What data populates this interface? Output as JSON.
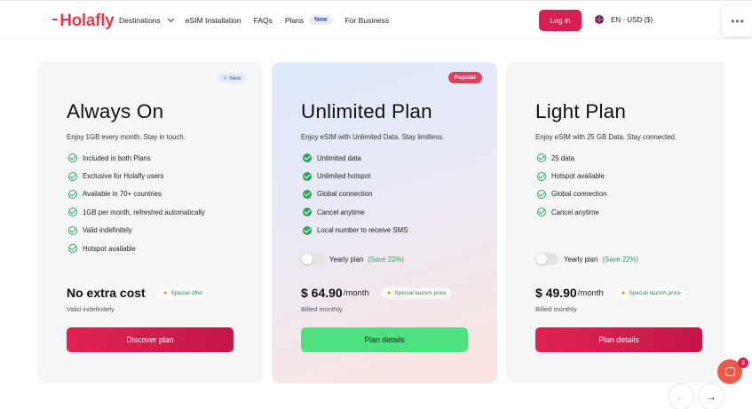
{
  "header": {
    "logo": "Holafly",
    "nav": [
      {
        "label": "Destinations"
      },
      {
        "label": "eSIM Installation"
      },
      {
        "label": "FAQs"
      },
      {
        "label": "Plans",
        "badge": "New"
      },
      {
        "label": "For Business"
      }
    ],
    "login_label": "Log in",
    "language": "EN - USD ($)",
    "more_icon": "ellipsis-icon"
  },
  "cards": [
    {
      "tag": "New",
      "title": "Always On",
      "description": "Enjoy 1GB every month. Stay in touch.",
      "features": [
        "Included in both Plans",
        "Exclusive for Holafly users",
        "Available in 70+ countries",
        "1GB per month, refreshed automatically",
        "Valid indefinitely",
        "Hotspot available"
      ],
      "price": "No extra cost",
      "offer": "Special offer",
      "billing": "Valid indefinitely",
      "cta": "Discover plan"
    },
    {
      "tag": "Popular",
      "title": "Unlimited Plan",
      "description": "Enjoy eSIM with Unlimited Data. Stay limitless.",
      "features": [
        "Unlimited data",
        "Unlimited hotspot",
        "Global connection",
        "Cancel anytime",
        "Local number to receive SMS"
      ],
      "yearly_label": "Yearly plan",
      "yearly_save": "(Save 22%)",
      "yearly_on": false,
      "price": "$ 64.90",
      "price_unit": "/month",
      "offer": "Special launch price",
      "billing": "Billed monthly",
      "cta": "Plan details"
    },
    {
      "title": "Light Plan",
      "description": "Enjoy eSIM with 25 GB Data. Stay connected.",
      "features": [
        "25 data",
        "Hotspot available",
        "Global connection",
        "Cancel anytime"
      ],
      "yearly_label": "Yearly plan",
      "yearly_save": "(Save 22%)",
      "yearly_on": false,
      "price": "$ 49.90",
      "price_unit": "/month",
      "offer": "Special launch price",
      "billing": "Billed monthly",
      "cta": "Plan details"
    }
  ],
  "chat": {
    "badge": "3"
  },
  "carousel": {
    "prev_icon": "arrow-left-icon",
    "next_icon": "arrow-right-icon"
  },
  "colors": {
    "brand": "#e63b4d",
    "cta_red": "#d81f4f",
    "cta_green": "#4fe07f",
    "check_green": "#2fa35e"
  }
}
